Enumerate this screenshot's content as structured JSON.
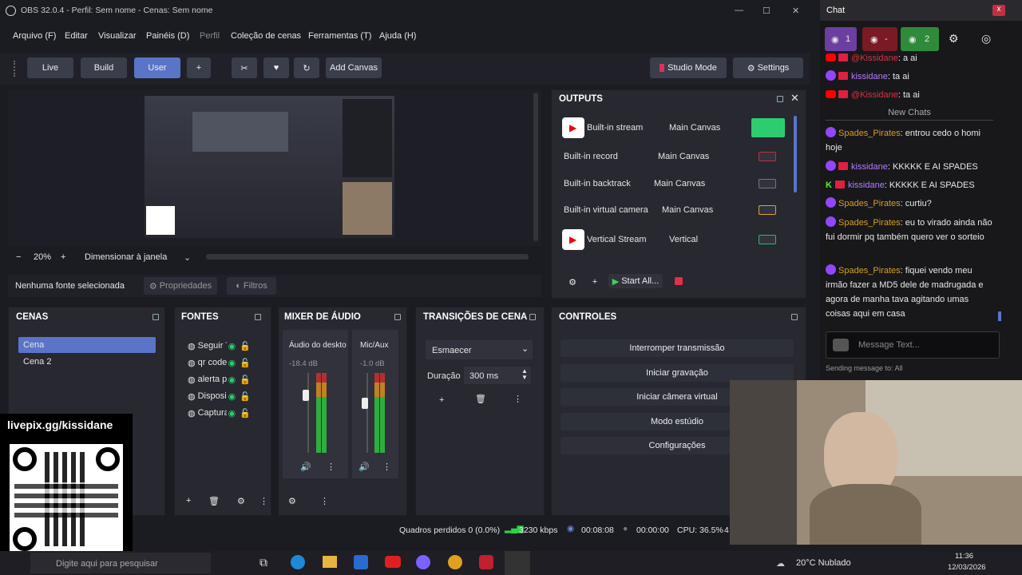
{
  "window": {
    "title": "OBS 32.0.4 - Perfil: Sem nome - Cenas: Sem nome",
    "minimize": "—",
    "maximize": "☐",
    "close": "✕"
  },
  "menu": [
    "Arquivo (F)",
    "Editar",
    "Visualizar",
    "Painéis (D)",
    "Perfil",
    "Coleção de cenas",
    "Ferramentas (T)",
    "Ajuda (H)"
  ],
  "toolbar": {
    "tabs": [
      "Live",
      "Build",
      "User"
    ],
    "add": "+",
    "add_canvas": "Add Canvas",
    "studio_mode": "Studio Mode",
    "settings": "Settings"
  },
  "zoom": {
    "minus": "−",
    "value": "20%",
    "plus": "+",
    "mode": "Dimensionar à janela"
  },
  "source_bar": {
    "none": "Nenhuma fonte selecionada",
    "properties": "Propriedades",
    "filters": "Filtros"
  },
  "outputs": {
    "title": "OUTPUTS",
    "rows": [
      {
        "name": "Built-in stream",
        "canvas": "Main Canvas",
        "yt": true
      },
      {
        "name": "Built-in record",
        "canvas": "Main Canvas",
        "yt": false
      },
      {
        "name": "Built-in backtrack",
        "canvas": "Main Canvas",
        "yt": false
      },
      {
        "name": "Built-in virtual camera",
        "canvas": "Main Canvas",
        "yt": false
      },
      {
        "name": "Vertical Stream",
        "canvas": "Vertical",
        "yt": true
      }
    ],
    "start_all": "Start All..."
  },
  "scenes": {
    "title": "CENAS",
    "items": [
      "Cena",
      "Cena 2"
    ]
  },
  "sources": {
    "title": "FONTES",
    "items": [
      "Seguir T",
      "qr code",
      "alerta pi",
      "Disposi",
      "Captura"
    ]
  },
  "mixer": {
    "title": "MIXER DE ÁUDIO",
    "channels": [
      {
        "name": "Áudio do deskto",
        "db": "-18.4 dB",
        "level": 0.72
      },
      {
        "name": "Mic/Aux",
        "db": "-1.0 dB",
        "level": 0.62
      }
    ]
  },
  "transitions": {
    "title": "TRANSIÇÕES DE CENA",
    "type": "Esmaecer",
    "duration_label": "Duração",
    "duration": "300 ms"
  },
  "controls": {
    "title": "CONTROLES",
    "buttons": [
      "Interromper transmissão",
      "Iniciar gravação",
      "Iniciar câmera virtual",
      "Modo estúdio",
      "Configurações"
    ]
  },
  "status": {
    "dropped": "Quadros perdidos 0 (0.0%)",
    "kbps": "3230 kbps",
    "live_time": "00:08:08",
    "rec_time": "00:00:00",
    "cpu": "CPU: 36.5%",
    "extra": "4"
  },
  "overlay": {
    "url": "livepix.gg/kissidane"
  },
  "chat": {
    "title": "Chat",
    "close": "x",
    "viewers_twitch": "1",
    "viewers_yt": "-",
    "viewers_total": "2",
    "new_chats": "New Chats",
    "messages_top": [
      {
        "user": "@Kissidane",
        "text": ": a ai",
        "platform": "yt"
      },
      {
        "user": "kissidane",
        "text": ": ta ai",
        "platform": "tw"
      },
      {
        "user": "@Kissidane",
        "text": ": ta ai",
        "platform": "yt"
      }
    ],
    "messages": [
      {
        "user": "Spades_Pirates",
        "text": ": entrou cedo o homi hoje",
        "platform": "tw"
      },
      {
        "user": "kissidane",
        "text": ": KKKKK E AI SPADES",
        "platform": "tw"
      },
      {
        "user": "kissidane",
        "text": ": KKKKK E AI SPADES",
        "platform": "kick"
      },
      {
        "user": "Spades_Pirates",
        "text": ": curtiu?",
        "platform": "tw"
      },
      {
        "user": "Spades_Pirates",
        "text": ": eu to virado ainda não fui dormir pq também quero ver o sorteio",
        "platform": "tw"
      },
      {
        "user": "Spades_Pirates",
        "text": ": fiquei vendo meu irmão fazer a MD5 dele de madrugada e agora de manha tava agitando umas coisas aqui em casa",
        "platform": "tw"
      }
    ],
    "input_placeholder": "Message Text...",
    "sending_to": "Sending message to: All"
  },
  "taskbar": {
    "search": "Digite aqui para pesquisar",
    "weather": "20°C  Nublado",
    "time": "11:36",
    "date": "12/03/2026"
  }
}
